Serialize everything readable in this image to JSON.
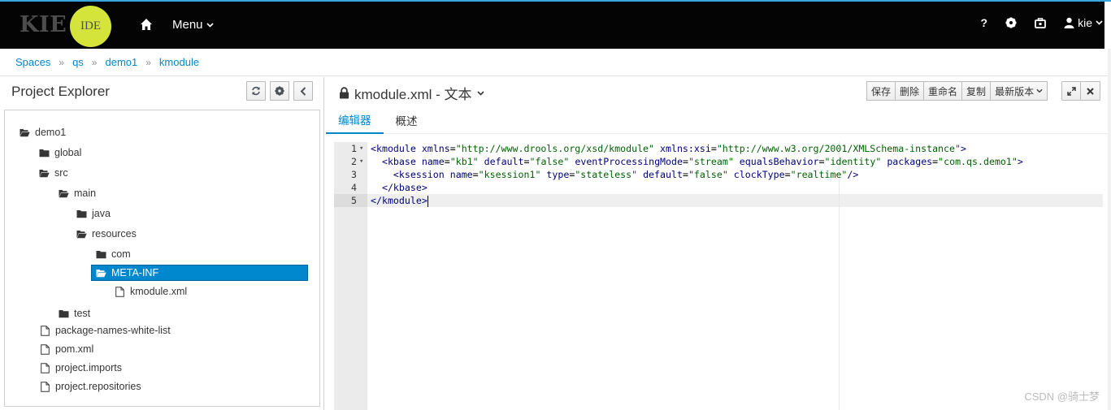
{
  "navbar": {
    "brand_kie": "KIE",
    "brand_ide": "IDE",
    "menu_label": "Menu",
    "user_label": "kie",
    "help_label": "?"
  },
  "breadcrumb": [
    "Spaces",
    "qs",
    "demo1",
    "kmodule"
  ],
  "project_explorer": {
    "title": "Project Explorer",
    "tree": [
      {
        "label": "demo1",
        "type": "folder-open"
      },
      {
        "label": "global",
        "type": "folder"
      },
      {
        "label": "src",
        "type": "folder-open"
      },
      {
        "label": "main",
        "type": "folder-open"
      },
      {
        "label": "java",
        "type": "folder"
      },
      {
        "label": "resources",
        "type": "folder-open"
      },
      {
        "label": "com",
        "type": "folder"
      },
      {
        "label": "META-INF",
        "type": "folder-open",
        "selected": true
      },
      {
        "label": "kmodule.xml",
        "type": "file"
      },
      {
        "label": "test",
        "type": "folder"
      },
      {
        "label": "package-names-white-list",
        "type": "file"
      },
      {
        "label": "pom.xml",
        "type": "file"
      },
      {
        "label": "project.imports",
        "type": "file"
      },
      {
        "label": "project.repositories",
        "type": "file"
      }
    ]
  },
  "editor": {
    "title": "kmodule.xml - 文本",
    "actions": [
      "保存",
      "删除",
      "重命名",
      "复制",
      "最新版本"
    ],
    "tabs": [
      "编辑器",
      "概述"
    ],
    "line_numbers": [
      "1",
      "2",
      "3",
      "4",
      "5"
    ],
    "code_lines": [
      "<kmodule xmlns=\"http://www.drools.org/xsd/kmodule\" xmlns:xsi=\"http://www.w3.org/2001/XMLSchema-instance\">",
      "  <kbase name=\"kb1\" default=\"false\" eventProcessingMode=\"stream\" equalsBehavior=\"identity\" packages=\"com.qs.demo1\">",
      "    <ksession name=\"ksession1\" type=\"stateless\" default=\"false\" clockType=\"realtime\"/>",
      "  </kbase>",
      "</kmodule>"
    ]
  },
  "watermark": "CSDN @骑士梦",
  "colors": {
    "accent": "#0088ce",
    "ide_logo": "#d4e43b",
    "navbar": "#040404"
  }
}
